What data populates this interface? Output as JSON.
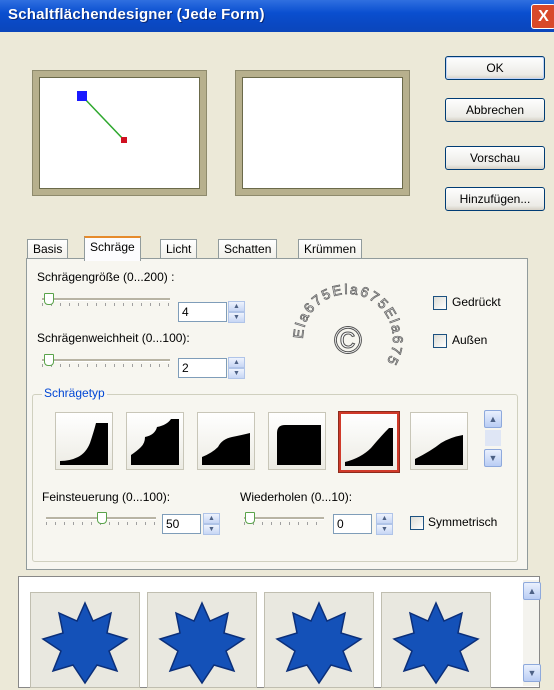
{
  "window": {
    "title": "Schaltflächendesigner (Jede Form)",
    "close_symbol": "X"
  },
  "buttons": {
    "ok": "OK",
    "cancel": "Abbrechen",
    "preview": "Vorschau",
    "add": "Hinzufügen..."
  },
  "tabs": [
    {
      "label": "Basis",
      "active": false
    },
    {
      "label": "Schräge",
      "active": true
    },
    {
      "label": "Licht",
      "active": false
    },
    {
      "label": "Schatten",
      "active": false
    },
    {
      "label": "Krümmen",
      "active": false
    }
  ],
  "bevel": {
    "size_label": "Schrägengröße (0...200) :",
    "size_value": "4",
    "size_fraction": 0.02,
    "softness_label": "Schrägenweichheit (0...100):",
    "softness_value": "2",
    "softness_fraction": 0.02,
    "pressed_label": "Gedrückt",
    "outside_label": "Außen",
    "type_group_label": "Schrägetyp",
    "fine_label": "Feinsteuerung (0...100):",
    "fine_value": "50",
    "fine_fraction": 0.5,
    "repeat_label": "Wiederholen (0...10):",
    "repeat_value": "0",
    "repeat_fraction": 0.0,
    "symmetric_label": "Symmetrisch",
    "selected_type_index": 4
  },
  "watermark": {
    "text": "Ela675Ela675Ela675",
    "symbol": "©"
  },
  "colors": {
    "accent": "#0a4fd0",
    "selected": "#d03a2a",
    "star": "#1451b8"
  }
}
